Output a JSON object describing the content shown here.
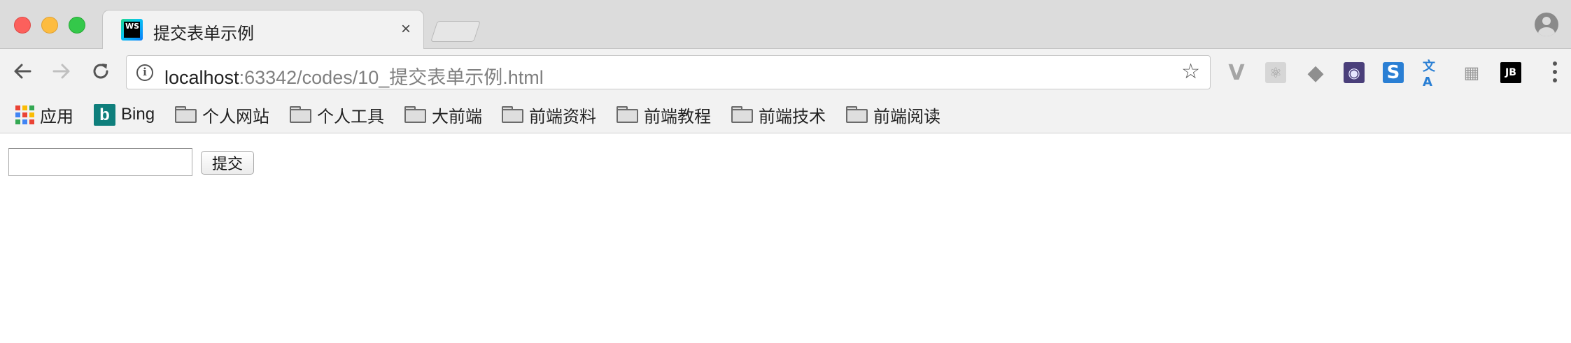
{
  "window": {
    "traffic_lights": [
      "close",
      "minimize",
      "maximize"
    ]
  },
  "tab": {
    "favicon_text": "WS",
    "title": "提交表单示例",
    "close_glyph": "×"
  },
  "toolbar": {
    "url_host": "localhost",
    "url_rest": ":63342/codes/10_提交表单示例.html",
    "info_glyph": "i",
    "star_glyph": "☆",
    "extensions": [
      {
        "name": "vue-devtools-icon",
        "glyph": "V"
      },
      {
        "name": "react-devtools-icon",
        "glyph": "⚛"
      },
      {
        "name": "layers-icon",
        "glyph": "◆"
      },
      {
        "name": "target-icon",
        "glyph": "◉"
      },
      {
        "name": "s-extension-icon",
        "glyph": "S"
      },
      {
        "name": "translate-icon",
        "glyph": "文A"
      },
      {
        "name": "grid-icon",
        "glyph": "▦"
      },
      {
        "name": "jetbrains-icon",
        "glyph": "JB"
      }
    ]
  },
  "bookmarks": [
    {
      "label": "应用",
      "icon": "apps-icon"
    },
    {
      "label": "Bing",
      "icon": "bing-icon"
    },
    {
      "label": "个人网站",
      "icon": "folder-icon"
    },
    {
      "label": "个人工具",
      "icon": "folder-icon"
    },
    {
      "label": "大前端",
      "icon": "folder-icon"
    },
    {
      "label": "前端资料",
      "icon": "folder-icon"
    },
    {
      "label": "前端教程",
      "icon": "folder-icon"
    },
    {
      "label": "前端技术",
      "icon": "folder-icon"
    },
    {
      "label": "前端阅读",
      "icon": "folder-icon"
    }
  ],
  "bing_glyph": "b",
  "form": {
    "input_value": "",
    "submit_label": "提交"
  },
  "colors": {
    "apps_grid": [
      "#ea4335",
      "#fbbc05",
      "#34a853",
      "#4285f4",
      "#ea4335",
      "#fbbc05",
      "#34a853",
      "#4285f4",
      "#ea4335"
    ]
  }
}
